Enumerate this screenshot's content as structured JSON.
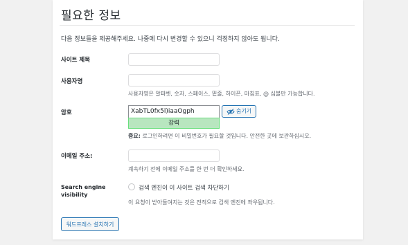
{
  "section": {
    "title": "필요한 정보",
    "intro": "다음 정보들을 제공해주세요. 나중에 다시 변경할 수 있으니 걱정하지 않아도 됩니다."
  },
  "site_title": {
    "label": "사이트 제목",
    "value": ""
  },
  "username": {
    "label": "사용자명",
    "value": "",
    "description": "사용자명은 알파벳, 숫자, 스페이스, 밑줄, 하이픈, 마침표, @ 심볼만 가능합니다."
  },
  "password": {
    "label": "암호",
    "value": "XabTL0fx5l)iaaOgph",
    "strength": "강력",
    "hide_label": "숨기기",
    "hide_icon": "eye-slash-icon",
    "note_bold": "중요:",
    "note": " 로그인하려면 이 비밀번호가 필요할 것입니다. 안전한 곳에 보관하십시오.",
    "strength_color": "#b8e6bf"
  },
  "email": {
    "label": "이메일 주소:",
    "value": "",
    "description": "계속하기 전에 이메일 주소를 한 번 더 확인하세요."
  },
  "search_visibility": {
    "label": "Search engine visibility",
    "checkbox_label": "검색 엔진이 이 사이트 검색 차단하기",
    "checked": false,
    "description": "이 요청이 받아들여지는 것은 전적으로 검색 엔진에 좌우됩니다."
  },
  "install_button": {
    "label": "워드프레스 설치하기"
  },
  "colors": {
    "accent": "#2271b1",
    "background": "#f1f1f1"
  }
}
